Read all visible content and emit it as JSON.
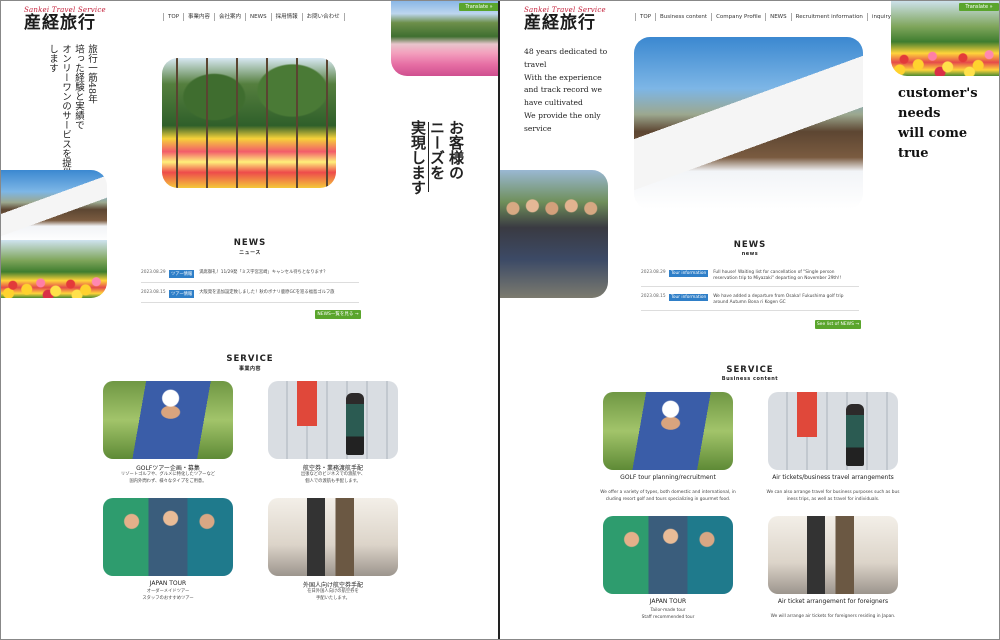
{
  "left": {
    "logo": {
      "en": "Sankei Travel Service",
      "jp": "産経旅行"
    },
    "nav": [
      "TOP",
      "事業内容",
      "会社案内",
      "NEWS",
      "採用情報",
      "お問い合わせ"
    ],
    "translate": "Translate »",
    "tagline": [
      "旅行一筋48年",
      "培った経験と実績で",
      "オンリーワンのサービスを提供いたします"
    ],
    "catch": [
      "お客様の",
      "ニーズを",
      "実現します"
    ],
    "news": {
      "title": "NEWS",
      "subtitle": "ニュース",
      "items": [
        {
          "date": "2023.08.29",
          "tag": "ツアー情報",
          "text": "満席御礼！11/29発「ミス宇宮宮崎」キャンセル待ちとなります？"
        },
        {
          "date": "2023.08.15",
          "tag": "ツアー情報",
          "text": "大阪発を追加設定致しました！秋のボナリ鹿原GCを巡る福島ゴルフ旅"
        }
      ],
      "more": "NEWS一覧を見る →"
    },
    "service": {
      "title": "SERVICE",
      "subtitle": "事業内容",
      "items": [
        {
          "title": "GOLFツアー企画・募集",
          "desc": [
            "リゾートゴルフや、グルメに特化したツアーなど",
            "国内外問わず、様々なタイプをご用意。"
          ]
        },
        {
          "title": "航空券・業務渡航手配",
          "desc": [
            "出張などのビジネスでの渡航や、",
            "個人での渡航も手配します。"
          ]
        },
        {
          "title": "JAPAN TOUR",
          "desc": [
            "オーダーメイドツアー",
            "スタッフのおすすめツアー"
          ]
        },
        {
          "title": "外国人向け航空券手配",
          "desc": [
            "在日外国人向けの航空券を",
            "手配いたします。"
          ]
        }
      ]
    }
  },
  "right": {
    "logo": {
      "en": "Sankei Travel Service",
      "jp": "産経旅行"
    },
    "nav": [
      "TOP",
      "Business content",
      "Company Profile",
      "NEWS",
      "Recruitment information",
      "inquiry"
    ],
    "translate": "Translate »",
    "tagline": [
      "48 years dedicated to",
      "travel",
      "With the experience",
      "and track record we",
      "have cultivated",
      "We provide the only",
      "service"
    ],
    "catch": [
      "customer's",
      "needs",
      "will come",
      "true"
    ],
    "news": {
      "title": "NEWS",
      "subtitle": "news",
      "items": [
        {
          "date": "2023.08.29",
          "tag": "Tour information",
          "text": "Full house! Waiting list for cancellation of \"Single person reservation trip to Miyazaki\" departing on November 29th!!"
        },
        {
          "date": "2023.08.15",
          "tag": "Tour information",
          "text": "We have added a departure from Osaka! Fukushima golf trip around Autumn Bona ri Kogen GC"
        }
      ],
      "more": "See list of NEWS →"
    },
    "service": {
      "title": "SERVICE",
      "subtitle": "Business content",
      "items": [
        {
          "title": "GOLF tour planning/recruitment",
          "desc": [
            "We offer a variety of types, both domestic and international, in",
            "cluding resort golf and tours specializing in gourmet food."
          ]
        },
        {
          "title": "Air tickets/business travel arrangements",
          "desc": [
            "We can also arrange travel for business purposes such as bus",
            "iness trips, as well as travel for individuals."
          ]
        },
        {
          "title": "JAPAN TOUR",
          "desc": [
            "Tailor-made tour",
            "Staff recommended tour"
          ]
        },
        {
          "title": "Air ticket arrangement for foreigners",
          "desc": [
            "We will arrange air tickets for foreigners residing in Japan."
          ]
        }
      ]
    }
  },
  "colors": {
    "accent_green": "#5aa52c",
    "tag_blue": "#2f7fc8",
    "logo_red": "#c4213b"
  },
  "icons": {
    "translate": "arrow-right-icon"
  }
}
